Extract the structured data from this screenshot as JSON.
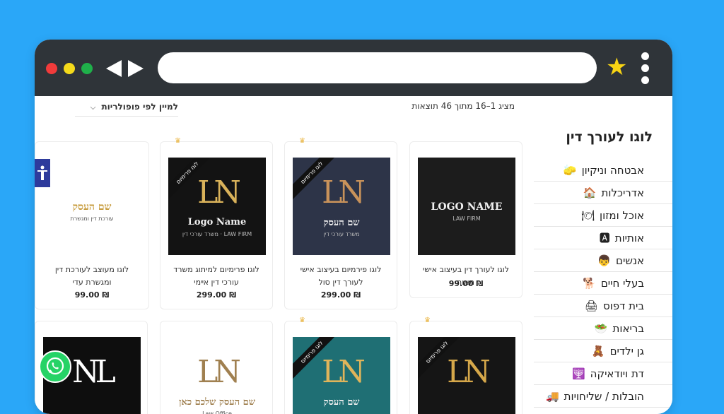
{
  "browser": {
    "address_value": "",
    "back_icon": "back-arrow-icon",
    "forward_icon": "forward-arrow-icon",
    "bookmark_icon": "star-icon",
    "menu_icon": "kebab-menu-icon",
    "colors": {
      "frame": "#2f3439",
      "background": "#2aa7f8",
      "close": "#f13b3b",
      "minimize": "#f4da1b",
      "maximize": "#1fb04a",
      "star": "#f8d414"
    }
  },
  "shop": {
    "results_count": "מציג 1–16 מתוך 46 תוצאות",
    "sort_label": "למיין לפי פופולריות",
    "sidebar_title": "לוגו לעורך דין",
    "categories": [
      {
        "label": "אבטחה וניקיון",
        "icon": "🧽"
      },
      {
        "label": "אדריכלות",
        "icon": "🏠"
      },
      {
        "label": "אוכל ומזון",
        "icon": "🍽"
      },
      {
        "label": "אותיות",
        "icon": "🅰"
      },
      {
        "label": "אנשים",
        "icon": "👦"
      },
      {
        "label": "בעלי חיים",
        "icon": "🐕"
      },
      {
        "label": "בית דפוס",
        "icon": "🖨"
      },
      {
        "label": "בריאות",
        "icon": "🥗"
      },
      {
        "label": "גן ילדים",
        "icon": "🧸"
      },
      {
        "label": "דת ויודאיקה",
        "icon": "🕎"
      },
      {
        "label": "הובלות / שליחויות",
        "icon": "🚚"
      }
    ],
    "products": [
      {
        "title": "לוגו לעורך דין בעיצוב אישי מאור",
        "price": "₪ 99.00",
        "premium": false,
        "logo": {
          "monogram": "",
          "name": "LOGO NAME",
          "sub": "LAW FIRM",
          "bg": "#1c1c1c",
          "fg": "#dddddd"
        }
      },
      {
        "title": "לוגו פירמיום בעיצוב אישי לעורך דין סול",
        "price": "₪ 299.00",
        "premium": true,
        "ribbon": "לוגו פרימיום",
        "logo": {
          "monogram": "LN",
          "name": "שם העסק",
          "sub": "משרד עורכי דין",
          "bg": "#2d3448",
          "fg": "#c8925a"
        }
      },
      {
        "title": "לוגו פרימיום למיתוג משרד עורכי דין אײמי",
        "price": "₪ 299.00",
        "premium": true,
        "ribbon": "לוגו פרימיום",
        "logo": {
          "monogram": "LN",
          "name": "Logo Name",
          "sub": "LAW FIRM · משרד עורכי דין",
          "bg": "#131313",
          "fg": "#d9b25a"
        }
      },
      {
        "title": "לוגו מעוצב לעורכת דין ומגשרת עדי",
        "price": "₪ 99.00",
        "premium": false,
        "logo": {
          "monogram": "",
          "name": "שם העסק",
          "sub": "עורכת דין ומגשרת",
          "bg": "#ffffff",
          "fg": "#c69a3a"
        }
      },
      {
        "title": "",
        "price": "",
        "premium": true,
        "ribbon": "לוגו פרימיום",
        "logo": {
          "monogram": "LN",
          "name": "",
          "sub": "",
          "bg": "#151515",
          "fg": "#d6a84a"
        }
      },
      {
        "title": "",
        "price": "",
        "premium": true,
        "ribbon": "לוגו פרימיום",
        "logo": {
          "monogram": "LN",
          "name": "שם העסק",
          "sub": "",
          "bg": "#1f6f74",
          "fg": "#e0b45a"
        }
      },
      {
        "title": "",
        "price": "",
        "premium": false,
        "logo": {
          "monogram": "LN",
          "name": "שם העסק שלכם כאן",
          "sub": "Law Office",
          "bg": "#ffffff",
          "fg": "#a08050"
        }
      },
      {
        "title": "",
        "price": "",
        "premium": false,
        "logo": {
          "monogram": "NL",
          "name": "",
          "sub": "",
          "bg": "#0e0e0e",
          "fg": "#ffffff"
        }
      }
    ]
  },
  "widgets": {
    "accessibility_icon": "accessibility-icon",
    "whatsapp_icon": "whatsapp-icon",
    "whatsapp_color": "#25d366",
    "accessibility_color": "#2e3b9c"
  }
}
